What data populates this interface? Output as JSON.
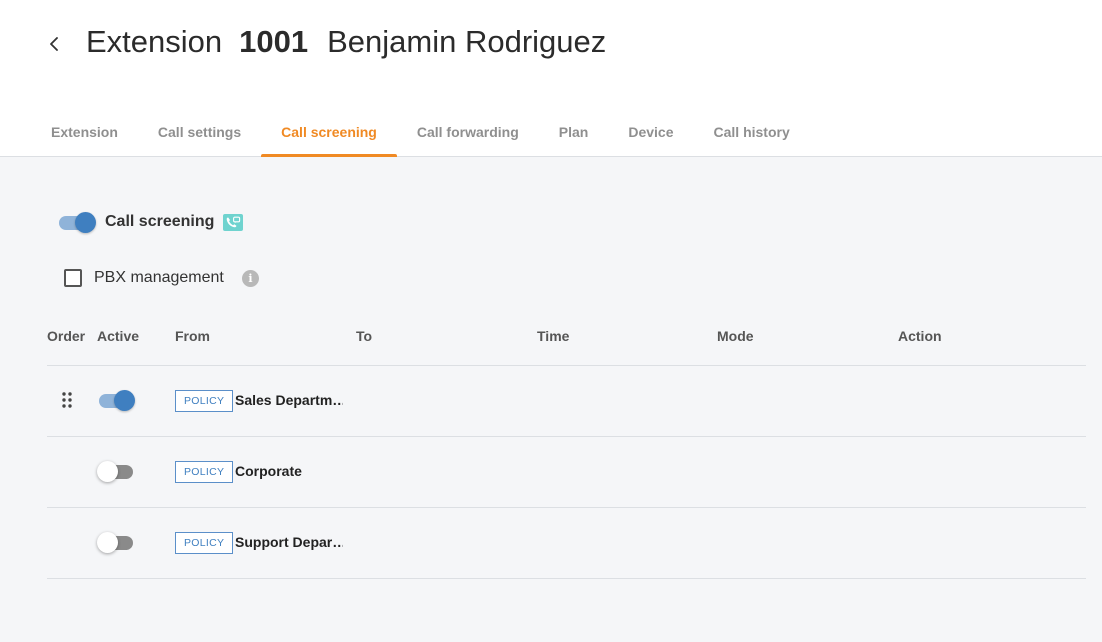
{
  "header": {
    "title_prefix": "Extension",
    "extension_number": "1001",
    "user_name": "Benjamin Rodriguez"
  },
  "tabs": [
    {
      "label": "Extension",
      "active": false
    },
    {
      "label": "Call settings",
      "active": false
    },
    {
      "label": "Call screening",
      "active": true
    },
    {
      "label": "Call forwarding",
      "active": false
    },
    {
      "label": "Plan",
      "active": false
    },
    {
      "label": "Device",
      "active": false
    },
    {
      "label": "Call history",
      "active": false
    }
  ],
  "call_screening": {
    "label": "Call screening",
    "enabled": true,
    "icon": "phone-screen-icon"
  },
  "pbx_management": {
    "label": "PBX management",
    "checked": false
  },
  "table": {
    "columns": [
      "Order",
      "Active",
      "From",
      "To",
      "Time",
      "Mode",
      "Action"
    ],
    "rows": [
      {
        "active": true,
        "badge": "POLICY",
        "from": "Sales Departm…",
        "to": "",
        "time": "",
        "mode": "",
        "action": ""
      },
      {
        "active": false,
        "badge": "POLICY",
        "from": "Corporate",
        "to": "",
        "time": "",
        "mode": "",
        "action": ""
      },
      {
        "active": false,
        "badge": "POLICY",
        "from": "Support Depar…",
        "to": "",
        "time": "",
        "mode": "",
        "action": ""
      }
    ]
  },
  "colors": {
    "accent": "#f08a24",
    "primary": "#3f7fc0",
    "background": "#f5f6f8",
    "screen_icon": "#6fd3cf"
  }
}
